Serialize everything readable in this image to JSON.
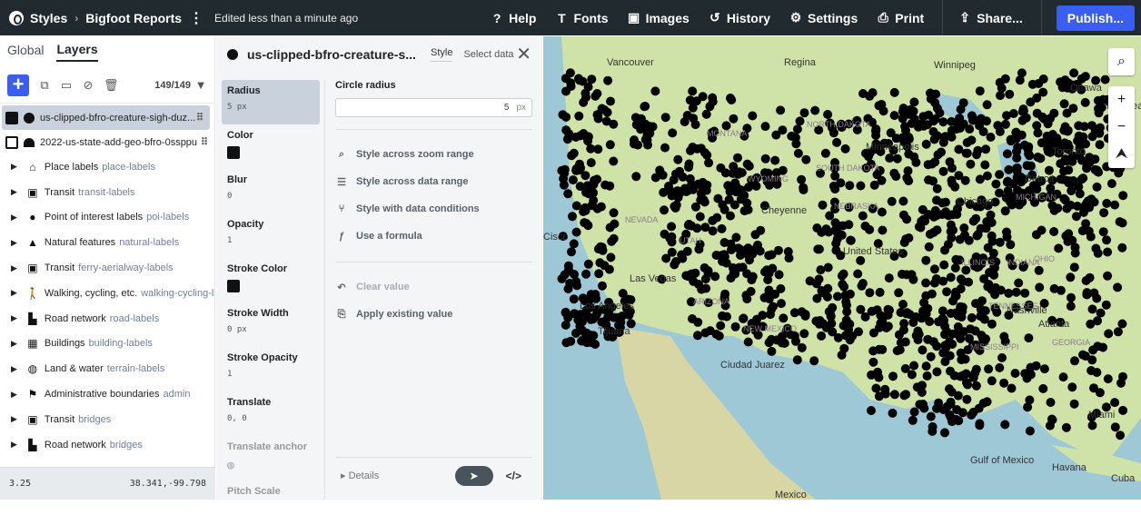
{
  "topbar": {
    "styles_label": "Styles",
    "project_title": "Bigfoot Reports",
    "edited_status": "Edited less than a minute ago",
    "buttons": [
      {
        "label": "Help",
        "icon": "help-icon"
      },
      {
        "label": "Fonts",
        "icon": "fonts-icon"
      },
      {
        "label": "Images",
        "icon": "images-icon"
      },
      {
        "label": "History",
        "icon": "history-icon"
      },
      {
        "label": "Settings",
        "icon": "gear-icon"
      },
      {
        "label": "Print",
        "icon": "printer-icon"
      }
    ],
    "share_label": "Share...",
    "publish_label": "Publish..."
  },
  "left_panel": {
    "tabs": [
      "Global",
      "Layers"
    ],
    "layer_count": "149/149",
    "layers": [
      {
        "name": "us-clipped-bfro-creature-sigh-duz...",
        "selected": true
      },
      {
        "name": "2022-us-state-add-geo-bfro-0ssppu",
        "selected": false
      }
    ],
    "groups": [
      {
        "name": "Place labels",
        "id": "place-labels",
        "icon": "place-icon"
      },
      {
        "name": "Transit",
        "id": "transit-labels",
        "icon": "transit-icon"
      },
      {
        "name": "Point of interest labels",
        "id": "poi-labels",
        "icon": "poi-icon"
      },
      {
        "name": "Natural features",
        "id": "natural-labels",
        "icon": "natural-icon"
      },
      {
        "name": "Transit",
        "id": "ferry-aerialway-labels",
        "icon": "transit-icon"
      },
      {
        "name": "Walking, cycling, etc.",
        "id": "walking-cycling-lal",
        "icon": "walking-icon"
      },
      {
        "name": "Road network",
        "id": "road-labels",
        "icon": "road-icon"
      },
      {
        "name": "Buildings",
        "id": "building-labels",
        "icon": "building-icon"
      },
      {
        "name": "Land & water",
        "id": "terrain-labels",
        "icon": "globe-icon"
      },
      {
        "name": "Administrative boundaries",
        "id": "admin",
        "icon": "flag-icon"
      },
      {
        "name": "Transit",
        "id": "bridges",
        "icon": "transit-icon"
      },
      {
        "name": "Road network",
        "id": "bridges",
        "icon": "road-icon"
      }
    ],
    "zoom": "3.25",
    "coords": "38.341,-99.798"
  },
  "mid_panel": {
    "layer_title": "us-clipped-bfro-creature-s...",
    "tab_style": "Style",
    "tab_select_data": "Select data",
    "properties": [
      {
        "name": "Radius",
        "value": "5 px",
        "type": "text"
      },
      {
        "name": "Color",
        "value": "#000000",
        "type": "swatch"
      },
      {
        "name": "Blur",
        "value": "0",
        "type": "text"
      },
      {
        "name": "Opacity",
        "value": "1",
        "type": "text"
      },
      {
        "name": "Stroke Color",
        "value": "#000000",
        "type": "swatch"
      },
      {
        "name": "Stroke Width",
        "value": "0 px",
        "type": "text"
      },
      {
        "name": "Stroke Opacity",
        "value": "1",
        "type": "text"
      },
      {
        "name": "Translate",
        "value": "0, 0",
        "type": "text"
      },
      {
        "name": "Translate anchor",
        "value": "",
        "type": "globe"
      },
      {
        "name": "Pitch Scale",
        "value": "",
        "type": "text"
      }
    ],
    "editor_title": "Circle radius",
    "editor_value": "5",
    "editor_unit": "px",
    "options": [
      "Style across zoom range",
      "Style across data range",
      "Style with data conditions",
      "Use a formula"
    ],
    "clear_value": "Clear value",
    "apply_existing": "Apply existing value",
    "details": "Details"
  },
  "map": {
    "labels": [
      "Vancouver",
      "Regina",
      "Winnipeg",
      "Ottawa",
      "Minneapolis",
      "MONTANA",
      "NORTH DAKOTA",
      "SOUTH DAKOTA",
      "WYOMING",
      "Cheyenne",
      "NEBRASKA",
      "NEVADA",
      "UTAH",
      "United States",
      "Las Vegas",
      "Los Angeles",
      "Tijuana",
      "ARIZONA",
      "NEW MEXICO",
      "Ciudad Juarez",
      "Gulf of Mexico",
      "Havana",
      "Cuba",
      "Mexico",
      "Cisco",
      "OHIO",
      "ILLINOIS",
      "MICHIGAN",
      "INDIANA",
      "MISSISSIPPI",
      "TENNESSEE",
      "GEORGIA",
      "Atlanta",
      "Nashville",
      "Miami",
      "Montreal",
      "Toronto",
      "Chicago",
      "Detroit"
    ]
  }
}
